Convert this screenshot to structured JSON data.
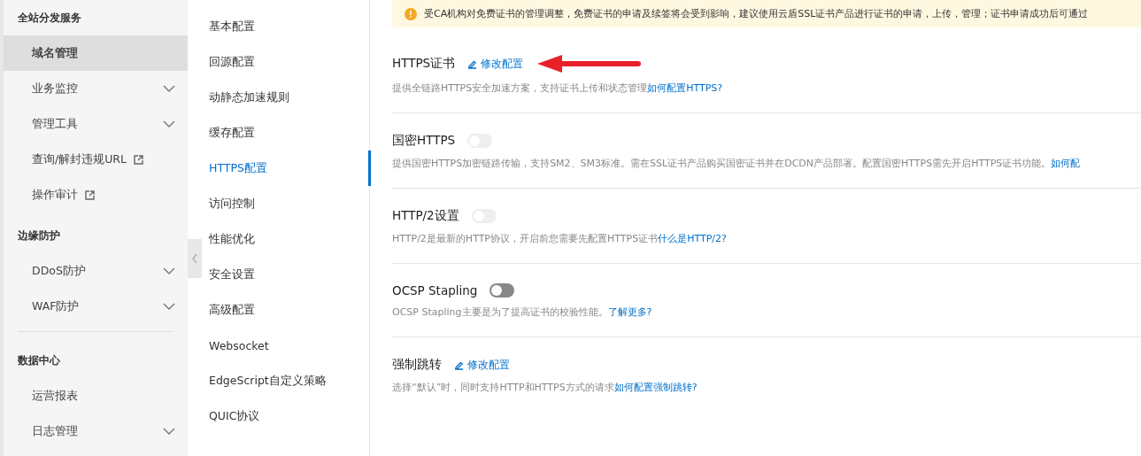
{
  "sidebar": {
    "groups": [
      {
        "title": "全站分发服务",
        "items": [
          {
            "label": "域名管理",
            "kind": "plain",
            "selected": true
          },
          {
            "label": "业务监控",
            "kind": "expand",
            "selected": false
          },
          {
            "label": "管理工具",
            "kind": "expand",
            "selected": false
          },
          {
            "label": "查询/解封违规URL",
            "kind": "external",
            "selected": false
          },
          {
            "label": "操作审计",
            "kind": "external",
            "selected": false
          }
        ]
      },
      {
        "title": "边缘防护",
        "items": [
          {
            "label": "DDoS防护",
            "kind": "expand",
            "selected": false
          },
          {
            "label": "WAF防护",
            "kind": "expand",
            "selected": false
          }
        ]
      },
      {
        "title": "数据中心",
        "items": [
          {
            "label": "运营报表",
            "kind": "plain",
            "selected": false
          },
          {
            "label": "日志管理",
            "kind": "expand",
            "selected": false
          }
        ]
      }
    ]
  },
  "subnav": {
    "items": [
      {
        "label": "基本配置",
        "selected": false
      },
      {
        "label": "回源配置",
        "selected": false
      },
      {
        "label": "动静态加速规则",
        "selected": false
      },
      {
        "label": "缓存配置",
        "selected": false
      },
      {
        "label": "HTTPS配置",
        "selected": true
      },
      {
        "label": "访问控制",
        "selected": false
      },
      {
        "label": "性能优化",
        "selected": false
      },
      {
        "label": "安全设置",
        "selected": false
      },
      {
        "label": "高级配置",
        "selected": false
      },
      {
        "label": "Websocket",
        "selected": false
      },
      {
        "label": "EdgeScript自定义策略",
        "selected": false
      },
      {
        "label": "QUIC协议",
        "selected": false
      }
    ]
  },
  "notice": {
    "text": "受CA机构对免费证书的管理调整，免费证书的申请及续签将会受到影响，建议使用云盾SSL证书产品进行证书的申请，上传，管理；证书申请成功后可通过"
  },
  "sections": [
    {
      "title": "HTTPS证书",
      "kind": "edit",
      "action": "修改配置",
      "description": "提供全链路HTTPS安全加速方案，支持证书上传和状态管理",
      "link": "如何配置HTTPS?"
    },
    {
      "title": "国密HTTPS",
      "kind": "toggle",
      "on": false,
      "disabled": true,
      "description": "提供国密HTTPS加密链路传输，支持SM2、SM3标准。需在SSL证书产品购买国密证书并在DCDN产品部署。配置国密HTTPS需先开启HTTPS证书功能。",
      "link": "如何配"
    },
    {
      "title": "HTTP/2设置",
      "kind": "toggle",
      "on": false,
      "disabled": true,
      "description": "HTTP/2是最新的HTTP协议，开启前您需要先配置HTTPS证书",
      "link": "什么是HTTP/2?"
    },
    {
      "title": "OCSP Stapling",
      "kind": "toggle",
      "on": false,
      "disabled": false,
      "description": "OCSP Stapling主要是为了提高证书的校验性能。",
      "link": "了解更多?"
    },
    {
      "title": "强制跳转",
      "kind": "edit",
      "action": "修改配置",
      "description": "选择“默认”时，同时支持HTTP和HTTPS方式的请求",
      "link": "如何配置强制跳转?"
    }
  ]
}
